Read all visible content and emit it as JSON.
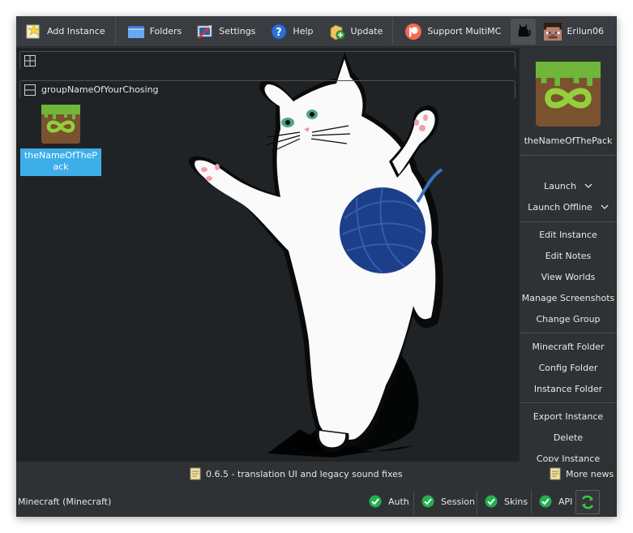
{
  "toolbar": {
    "add_instance": "Add Instance",
    "folders": "Folders",
    "settings": "Settings",
    "help": "Help",
    "update": "Update",
    "support": "Support MultiMC",
    "account": "Erilun06"
  },
  "groups": {
    "uncategorized_label": "",
    "named": "groupNameOfYourChosing"
  },
  "instance": {
    "name": "theNameOfThePack"
  },
  "side_panel": {
    "name": "theNameOfThePack",
    "launch": "Launch",
    "launch_offline": "Launch Offline",
    "edit_instance": "Edit Instance",
    "edit_notes": "Edit Notes",
    "view_worlds": "View Worlds",
    "manage_screenshots": "Manage Screenshots",
    "change_group": "Change Group",
    "minecraft_folder": "Minecraft Folder",
    "config_folder": "Config Folder",
    "instance_folder": "Instance Folder",
    "export_instance": "Export Instance",
    "delete": "Delete",
    "copy_instance": "Copy Instance"
  },
  "news": {
    "headline": "0.6.5 - translation UI and legacy sound fixes",
    "more_news": "More news"
  },
  "status": {
    "minecraft": "Minecraft  (Minecraft)",
    "auth": "Auth",
    "session": "Session",
    "skins": "Skins",
    "api": "API"
  },
  "colors": {
    "window_bg": "#2f3235",
    "instance_area_bg": "#202326",
    "selection": "#3daee9",
    "status_ok": "#22b14c"
  },
  "icons": {
    "add_instance": "new-instance-icon",
    "folders": "folder-icon",
    "settings": "settings-icon",
    "help": "help-icon",
    "update": "update-icon",
    "support": "patreon-icon",
    "cat": "cat-icon",
    "account": "steve-avatar-icon",
    "instance": "infinity-grass-block-icon",
    "news": "news-note-icon",
    "status": "check-icon",
    "refresh": "refresh-icon"
  }
}
